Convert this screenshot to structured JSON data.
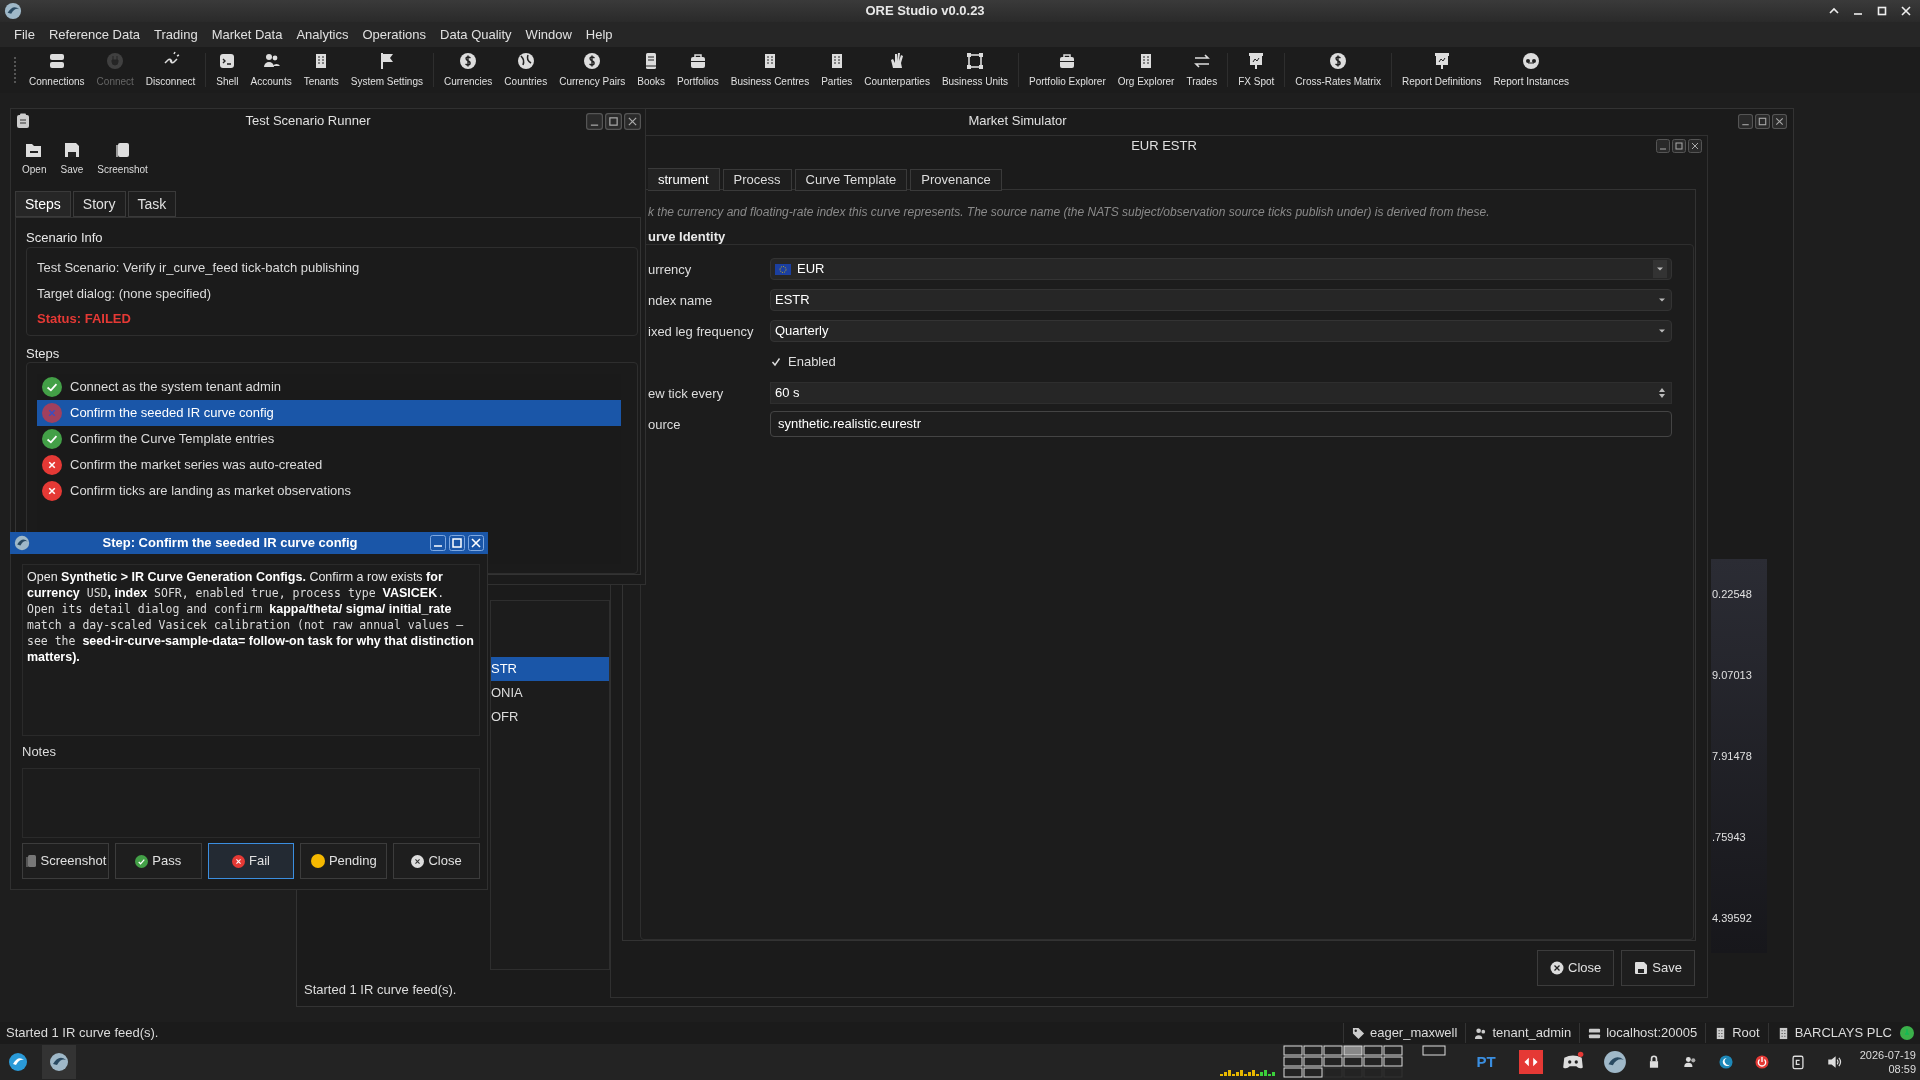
{
  "app": {
    "title": "ORE Studio v0.0.23"
  },
  "menu": [
    "File",
    "Reference Data",
    "Trading",
    "Market Data",
    "Analytics",
    "Operations",
    "Data Quality",
    "Window",
    "Help"
  ],
  "toolbar": [
    {
      "kind": "button",
      "label": "Connections",
      "disabled": false
    },
    {
      "kind": "button",
      "label": "Connect",
      "disabled": true
    },
    {
      "kind": "button",
      "label": "Disconnect",
      "disabled": false
    },
    {
      "kind": "separator"
    },
    {
      "kind": "button",
      "label": "Shell",
      "disabled": false
    },
    {
      "kind": "button",
      "label": "Accounts",
      "disabled": false
    },
    {
      "kind": "button",
      "label": "Tenants",
      "disabled": false
    },
    {
      "kind": "button",
      "label": "System Settings",
      "disabled": false
    },
    {
      "kind": "separator"
    },
    {
      "kind": "button",
      "label": "Currencies",
      "disabled": false
    },
    {
      "kind": "button",
      "label": "Countries",
      "disabled": false
    },
    {
      "kind": "button",
      "label": "Currency Pairs",
      "disabled": false
    },
    {
      "kind": "button",
      "label": "Books",
      "disabled": false
    },
    {
      "kind": "button",
      "label": "Portfolios",
      "disabled": false
    },
    {
      "kind": "button",
      "label": "Business Centres",
      "disabled": false
    },
    {
      "kind": "button",
      "label": "Parties",
      "disabled": false
    },
    {
      "kind": "button",
      "label": "Counterparties",
      "disabled": false
    },
    {
      "kind": "button",
      "label": "Business Units",
      "disabled": false
    },
    {
      "kind": "separator"
    },
    {
      "kind": "button",
      "label": "Portfolio Explorer",
      "disabled": false
    },
    {
      "kind": "button",
      "label": "Org Explorer",
      "disabled": false
    },
    {
      "kind": "button",
      "label": "Trades",
      "disabled": false
    },
    {
      "kind": "separator"
    },
    {
      "kind": "button",
      "label": "FX Spot",
      "disabled": false
    },
    {
      "kind": "separator"
    },
    {
      "kind": "button",
      "label": "Cross-Rates Matrix",
      "disabled": false
    },
    {
      "kind": "separator"
    },
    {
      "kind": "button",
      "label": "Report Definitions",
      "disabled": false
    },
    {
      "kind": "button",
      "label": "Report Instances",
      "disabled": false
    }
  ],
  "market_simulator": {
    "title": "Market Simulator",
    "list": [
      {
        "label": "STR",
        "selected": true
      },
      {
        "label": "ONIA",
        "selected": false
      },
      {
        "label": "OFR",
        "selected": false
      }
    ],
    "status": "Started 1 IR curve feed(s).",
    "axis_labels": [
      "0.22548",
      "9.07013",
      "7.91478",
      ".75943",
      "4.39592"
    ]
  },
  "curve_dialog": {
    "title": "EUR ESTR",
    "tabs": [
      {
        "label": "strument",
        "selected": true
      },
      {
        "label": "Process",
        "selected": false
      },
      {
        "label": "Curve Template",
        "selected": false
      },
      {
        "label": "Provenance",
        "selected": false
      }
    ],
    "hint": "k the currency and floating-rate index this curve represents. The source name (the NATS subject/observation source ticks publish under) is derived from these.",
    "group": "urve Identity",
    "fields": [
      {
        "kind": "currency",
        "label": "urrency",
        "value": "EUR"
      },
      {
        "kind": "combo",
        "label": "ndex name",
        "value": "ESTR"
      },
      {
        "kind": "combo",
        "label": "ixed leg frequency",
        "value": "Quarterly"
      },
      {
        "kind": "checkbox",
        "label": "Enabled",
        "checked": true
      },
      {
        "kind": "spin",
        "label": "ew tick every",
        "value": "60 s"
      },
      {
        "kind": "text",
        "label": "ource",
        "value": "synthetic.realistic.eurestr"
      }
    ],
    "buttons": [
      {
        "kind": "close",
        "label": "Close"
      },
      {
        "kind": "save",
        "label": "Save"
      }
    ]
  },
  "runner": {
    "title": "Test Scenario Runner",
    "tools": [
      "Open",
      "Save",
      "Screenshot"
    ],
    "tabs": [
      {
        "label": "Steps",
        "selected": true
      },
      {
        "label": "Story",
        "selected": false
      },
      {
        "label": "Task",
        "selected": false
      }
    ],
    "info_heading": "Scenario Info",
    "info_lines": [
      {
        "kind": "plain",
        "text": "Test Scenario: Verify ir_curve_feed tick-batch publishing"
      },
      {
        "kind": "plain",
        "text": "Target dialog: (none specified)"
      },
      {
        "kind": "status",
        "text": "Status: FAILED"
      }
    ],
    "steps_heading": "Steps",
    "steps": [
      {
        "label": "Connect as the system tenant admin",
        "passed": true,
        "selected": false
      },
      {
        "label": "Confirm the seeded IR curve config",
        "passed": false,
        "selected": true
      },
      {
        "label": "Confirm the Curve Template entries",
        "passed": true,
        "selected": false
      },
      {
        "label": "Confirm the market series was auto-created",
        "passed": false,
        "selected": false
      },
      {
        "label": "Confirm ticks are landing as market observations",
        "passed": false,
        "selected": false
      }
    ]
  },
  "step_dialog": {
    "title": "Step: Confirm the seeded IR curve config",
    "description": [
      {
        "kind": "plain",
        "text": "Open "
      },
      {
        "kind": "bold",
        "text": "Synthetic > IR Curve Generation Configs."
      },
      {
        "kind": "plain",
        "text": " Confirm a row exists "
      },
      {
        "kind": "bold",
        "text": "for currency"
      },
      {
        "kind": "mono",
        "text": " USD"
      },
      {
        "kind": "bold",
        "text": ", index"
      },
      {
        "kind": "mono",
        "text": " SOFR, enabled true, process type "
      },
      {
        "kind": "bold",
        "text": "VASICEK"
      },
      {
        "kind": "mono",
        "text": ". Open its detail dialog and confirm "
      },
      {
        "kind": "bold",
        "text": "kappa/theta/ sigma/ initial_rate"
      },
      {
        "kind": "mono",
        "text": " match a day-scaled Vasicek calibration (not raw annual values — see the "
      },
      {
        "kind": "bold",
        "text": "seed-ir-curve-sample-data= follow-on task for why that distinction matters)."
      }
    ],
    "notes_label": "Notes",
    "buttons": [
      {
        "kind": "screenshot",
        "label": "Screenshot",
        "selected": false
      },
      {
        "kind": "pass",
        "label": "Pass",
        "selected": false
      },
      {
        "kind": "fail",
        "label": "Fail",
        "selected": true
      },
      {
        "kind": "pending",
        "label": "Pending",
        "selected": false
      },
      {
        "kind": "close",
        "label": "Close",
        "selected": false
      }
    ]
  },
  "status_bar": {
    "message": "Started 1 IR curve feed(s).",
    "items": [
      {
        "kind": "tag",
        "label": "eager_maxwell"
      },
      {
        "kind": "user",
        "label": "tenant_admin"
      },
      {
        "kind": "server",
        "label": "localhost:20005"
      },
      {
        "kind": "building",
        "label": "Root"
      },
      {
        "kind": "building",
        "label": "BARCLAYS PLC"
      }
    ]
  },
  "taskbar": {
    "tray_text": "PT",
    "date": "2026-07-19",
    "time": "08:59"
  }
}
